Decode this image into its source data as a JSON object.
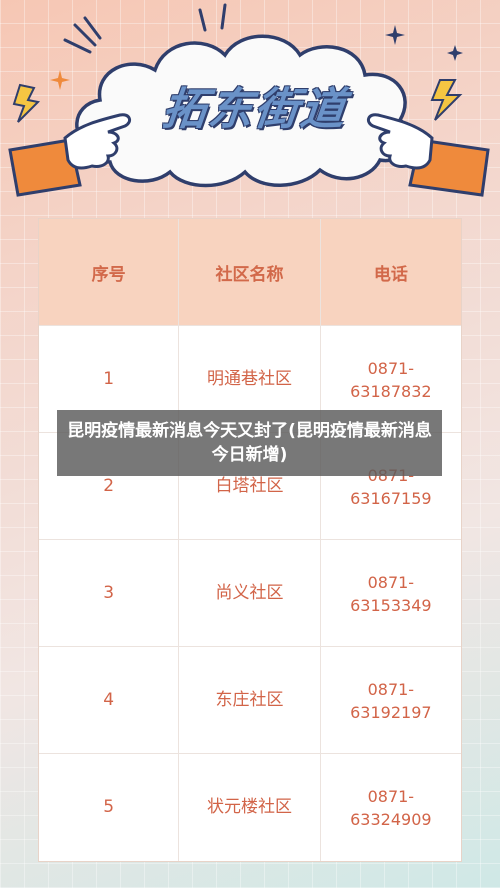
{
  "banner": {
    "title": "拓东街道"
  },
  "table": {
    "headers": [
      "序号",
      "社区名称",
      "电话"
    ],
    "rows": [
      {
        "no": "1",
        "name": "明通巷社区",
        "phone": "0871-\n63187832"
      },
      {
        "no": "2",
        "name": "白塔社区",
        "phone": "0871-\n63167159"
      },
      {
        "no": "3",
        "name": "尚义社区",
        "phone": "0871-\n63153349"
      },
      {
        "no": "4",
        "name": "东庄社区",
        "phone": "0871-\n63192197"
      },
      {
        "no": "5",
        "name": "状元楼社区",
        "phone": "0871-\n63324909"
      }
    ]
  },
  "overlay": {
    "text": "昆明疫情最新消息今天又封了(昆明疫情最新消息今日新增)"
  },
  "colors": {
    "accent": "#d26448",
    "header_bg": "#f8d3bf",
    "title_blue": "#6a92c8",
    "outline": "#2f3e6c",
    "sleeve": "#ef8a3c"
  }
}
